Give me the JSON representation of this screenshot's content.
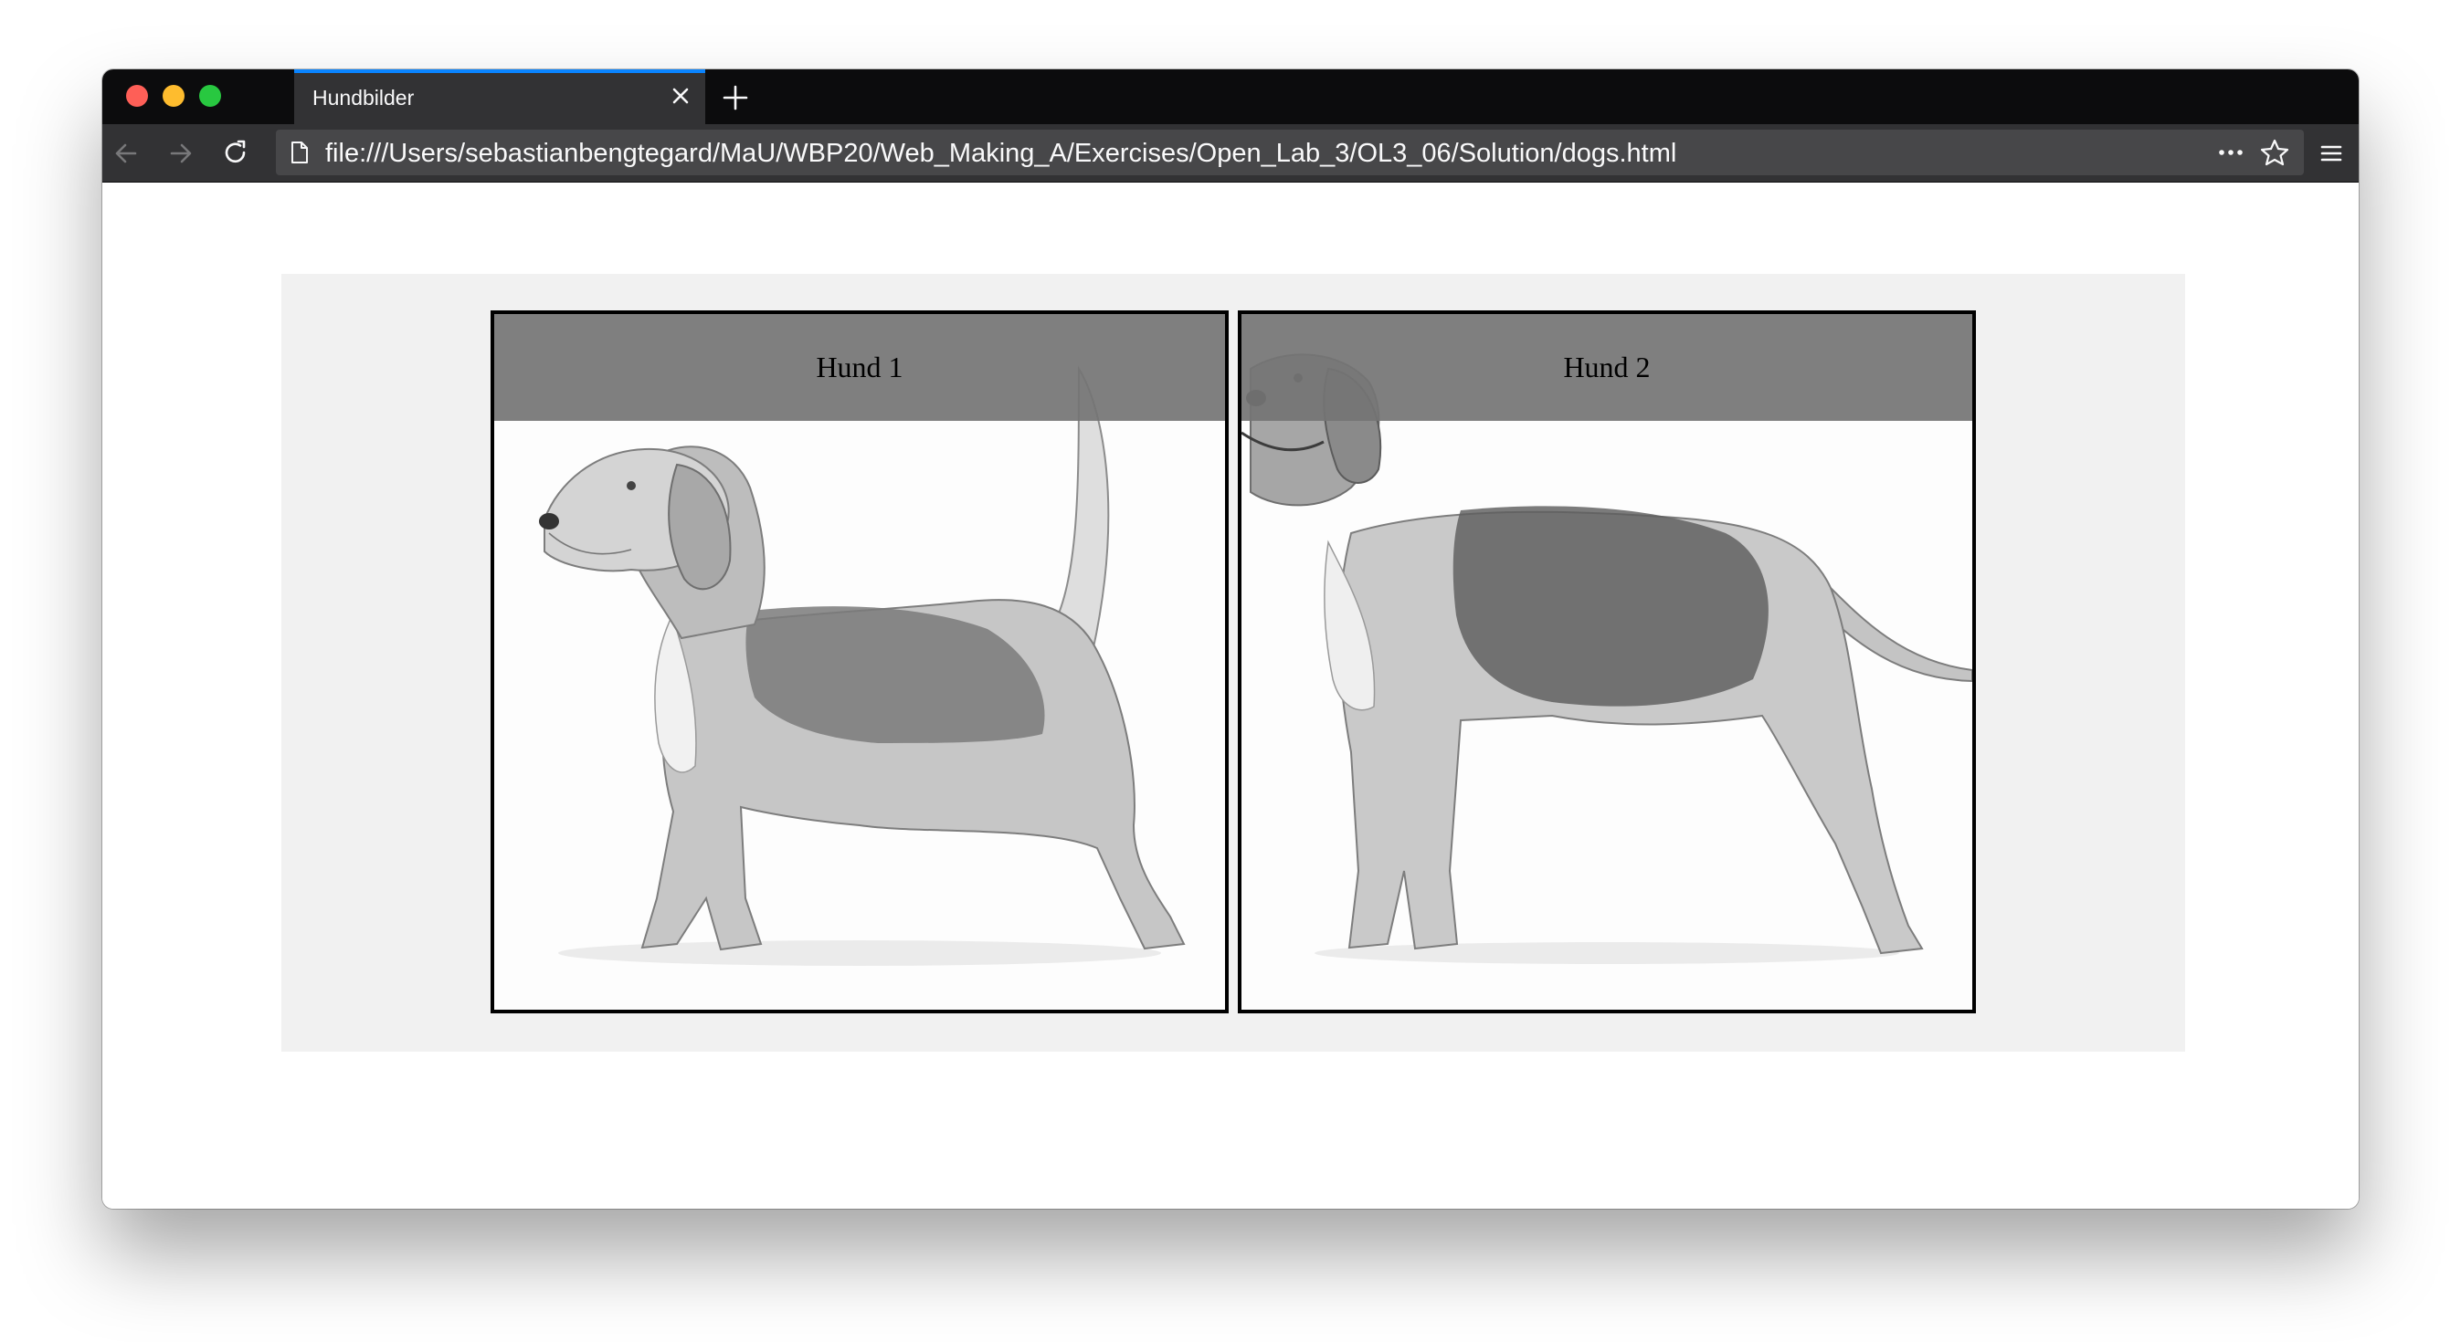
{
  "browser": {
    "tab": {
      "title": "Hundbilder"
    },
    "url": "file:///Users/sebastianbengtegard/MaU/WBP20/Web_Making_A/Exercises/Open_Lab_3/OL3_06/Solution/dogs.html",
    "icons": [
      "back-arrow-icon",
      "forward-arrow-icon",
      "reload-icon",
      "page-icon",
      "more-icon",
      "bookmark-star-icon",
      "hamburger-menu-icon",
      "close-icon",
      "plus-icon"
    ],
    "colors": {
      "tab_accent": "#0a84ff",
      "chrome_dark": "#0c0c0d",
      "toolbar": "#323234"
    }
  },
  "page": {
    "gallery": {
      "background": "#f1f1f1",
      "images": [
        {
          "caption": "Hund 1",
          "subject": "beagle-pencil-drawing"
        },
        {
          "caption": "Hund 2",
          "subject": "foxhound-pencil-drawing"
        }
      ]
    }
  }
}
